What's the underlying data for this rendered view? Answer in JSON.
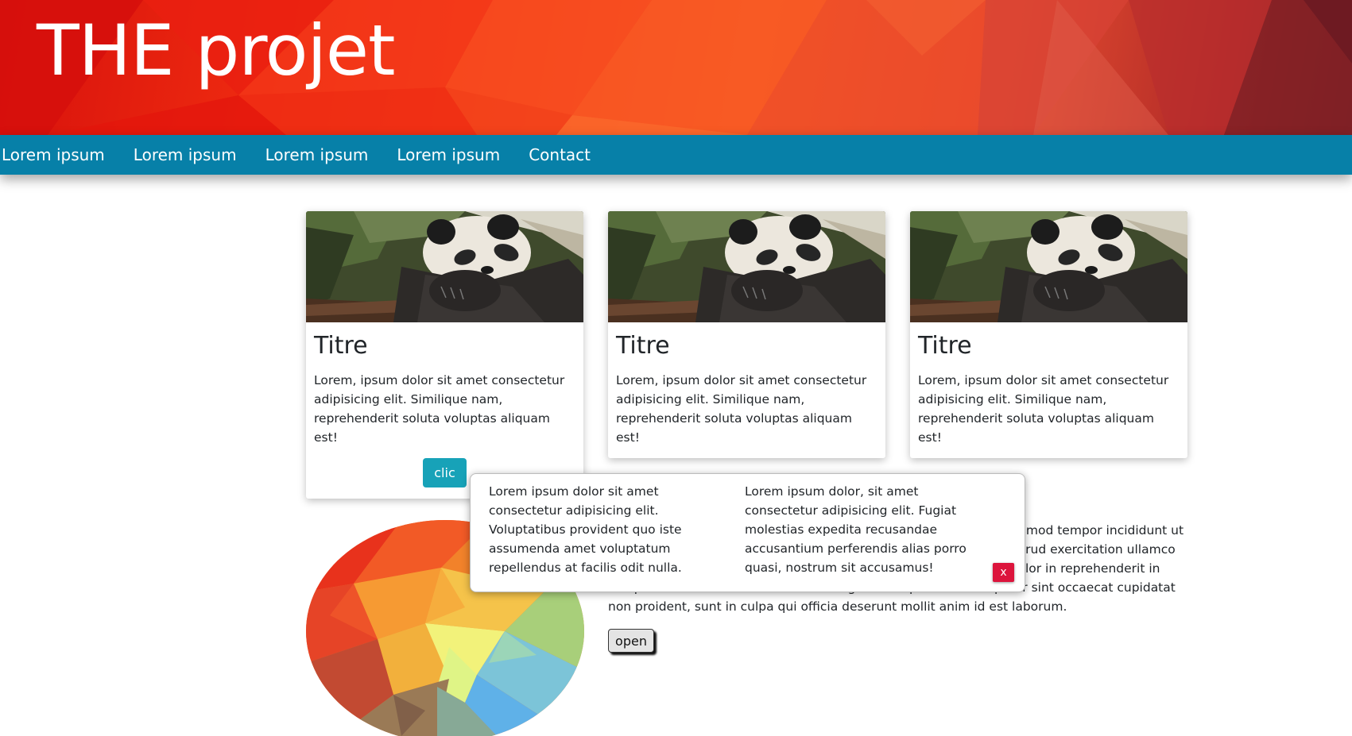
{
  "header": {
    "title": "THE projet"
  },
  "nav": {
    "items": [
      {
        "label": "Lorem ipsum"
      },
      {
        "label": "Lorem ipsum"
      },
      {
        "label": "Lorem ipsum"
      },
      {
        "label": "Lorem ipsum"
      },
      {
        "label": "Contact"
      }
    ]
  },
  "cards": [
    {
      "image": "panda-photo",
      "title": "Titre",
      "text": "Lorem, ipsum dolor sit amet consectetur adipisicing elit. Similique nam, reprehenderit soluta voluptas aliquam est!",
      "button": "clic"
    },
    {
      "image": "panda-photo",
      "title": "Titre",
      "text": "Lorem, ipsum dolor sit amet consectetur adipisicing elit. Similique nam, reprehenderit soluta voluptas aliquam est!"
    },
    {
      "image": "panda-photo",
      "title": "Titre",
      "text": "Lorem, ipsum dolor sit amet consectetur adipisicing elit. Similique nam, reprehenderit soluta voluptas aliquam est!"
    }
  ],
  "section": {
    "image": "low-poly-rainbow-blob",
    "paragraph": "Lorem ipsum dolor sit amet, consectetur adipiscing elit, sed do eiusmod tempor incididunt ut labore et dolore magna aliqua. Ut enim ad minim veniam, quis nostrud exercitation ullamco laboris nisi ut aliquip ex ea commodo consequat. Duis aute irure dolor in reprehenderit in voluptate velit esse cillum dolore eu fugiat nulla pariatur. Excepteur sint occaecat cupidatat non proident, sunt in culpa qui officia deserunt mollit anim id est laborum.",
    "open_label": "open"
  },
  "modal": {
    "col1": "Lorem ipsum dolor sit amet consectetur adipisicing elit. Voluptatibus provident quo iste assumenda amet voluptatum repellendus at facilis odit nulla.",
    "col2": "Lorem ipsum dolor, sit amet consectetur adipisicing elit. Fugiat molestias expedita recusandae accusantium perferendis alias porro quasi, nostrum sit accusamus!",
    "close_label": "x"
  },
  "colors": {
    "nav_bg": "#0780a8",
    "button_clic": "#17a2b8",
    "close_button": "#dc143c",
    "header_red": "#e8220f"
  }
}
